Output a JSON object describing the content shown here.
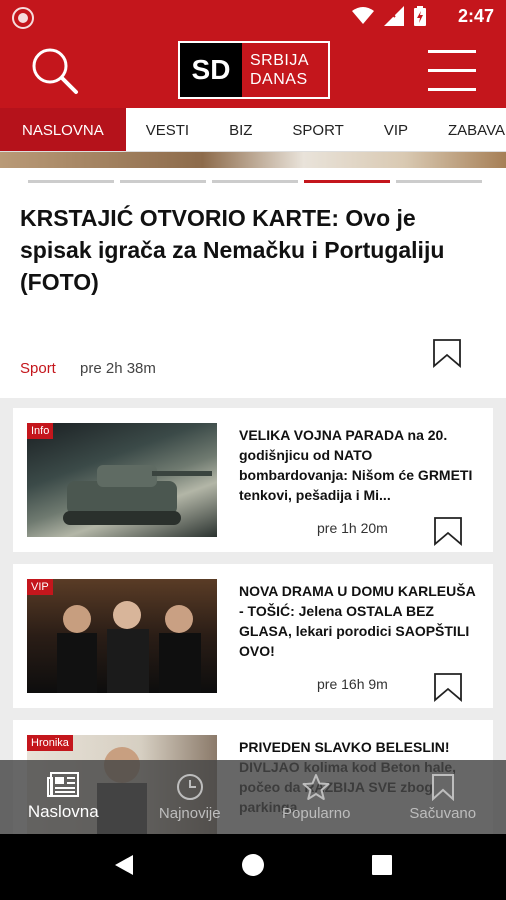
{
  "status_bar": {
    "time": "2:47"
  },
  "header": {
    "logo_abbr": "SD",
    "logo_line1": "SRBIJA",
    "logo_line2": "DANAS"
  },
  "tabs": [
    {
      "label": "NASLOVNA",
      "active": true
    },
    {
      "label": "VESTI"
    },
    {
      "label": "BIZ"
    },
    {
      "label": "SPORT"
    },
    {
      "label": "VIP"
    },
    {
      "label": "ZABAVA"
    }
  ],
  "hero": {
    "title": "KRSTAJIĆ OTVORIO KARTE: Ovo je spisak igrača za Nemačku i Portugaliju (FOTO)",
    "category": "Sport",
    "time": "pre 2h 38m"
  },
  "articles": [
    {
      "badge": "Info",
      "title": "VELIKA VOJNA PARADA na 20. godišnjicu od NATO bombardovanja: Nišom će GRMETI tenkovi, pešadija i Mi...",
      "time": "pre 1h 20m"
    },
    {
      "badge": "VIP",
      "title": "NOVA DRAMA U DOMU KARLEUŠA - TOŠIĆ: Jelena OSTALA BEZ GLASA, lekari porodici SAOPŠTILI OVO!",
      "time": "pre 16h 9m"
    },
    {
      "badge": "Hronika",
      "title": "PRIVEDEN SLAVKO BELESLIN! DIVLJAO kolima kod Beton hale, počeo da RAZBIJA SVE zbog parkinga"
    }
  ],
  "bottom_nav": [
    {
      "label": "Naslovna",
      "icon": "newspaper-icon",
      "active": true
    },
    {
      "label": "Najnovije",
      "icon": "clock-icon"
    },
    {
      "label": "Popularno",
      "icon": "star-icon"
    },
    {
      "label": "Sačuvano",
      "icon": "bookmark-icon"
    }
  ],
  "colors": {
    "brand_red": "#c4161c",
    "tab_active": "#b5121b"
  }
}
